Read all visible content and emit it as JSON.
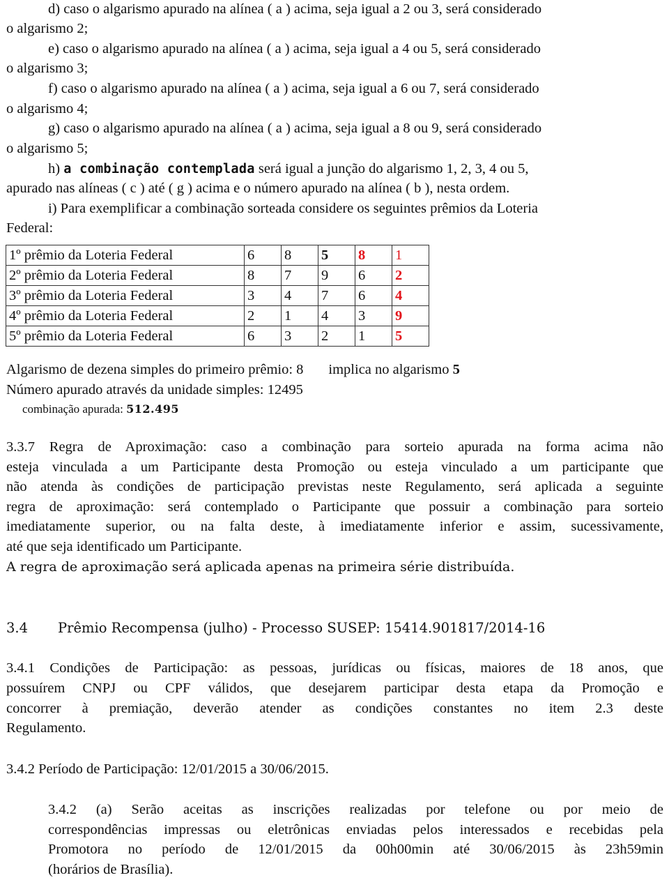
{
  "items": {
    "d": {
      "l1": "d) caso o algarismo apurado na alínea ( a ) acima, seja igual a 2 ou 3, será considerado",
      "l2": "o algarismo 2;"
    },
    "e": {
      "l1": "e) caso o algarismo apurado na alínea ( a ) acima, seja igual a 4 ou 5, será considerado",
      "l2": "o algarismo 3;"
    },
    "f": {
      "l1": "f) caso o algarismo apurado na alínea ( a ) acima, seja igual a 6 ou 7, será considerado",
      "l2": "o algarismo 4;"
    },
    "g": {
      "l1": "g) caso o algarismo apurado na alínea ( a ) acima, seja igual a 8 ou 9, será considerado",
      "l2": "o algarismo 5;"
    },
    "h": {
      "prefix": "h) ",
      "bold": "a combinação contemplada",
      "rest": " será igual a junção do algarismo 1, 2, 3, 4 ou 5,",
      "l2": "apurado nas alíneas ( c ) até ( g ) acima e o número apurado na alínea ( b ), nesta ordem."
    },
    "i": {
      "l1": "i) Para exemplificar a combinação sorteada considere os seguintes prêmios da Loteria",
      "l2": "Federal:"
    }
  },
  "lottery_table": [
    {
      "label": "1º prêmio da Loteria Federal",
      "digits": [
        "6",
        "8",
        "5",
        "8",
        "1"
      ]
    },
    {
      "label": "2º prêmio da Loteria Federal",
      "digits": [
        "8",
        "7",
        "9",
        "6",
        "2"
      ]
    },
    {
      "label": "3º prêmio da Loteria Federal",
      "digits": [
        "3",
        "4",
        "7",
        "6",
        "4"
      ]
    },
    {
      "label": "4º prêmio da Loteria Federal",
      "digits": [
        "2",
        "1",
        "4",
        "3",
        "9"
      ]
    },
    {
      "label": "5º prêmio da Loteria Federal",
      "digits": [
        "6",
        "3",
        "2",
        "1",
        "5"
      ]
    }
  ],
  "example": {
    "dezena_label": "Algarismo de dezena simples do primeiro prêmio: 8",
    "implica_label": "implica no algarismo ",
    "implica_value": "5",
    "numero_label": "Número apurado através da unidade simples: 12495",
    "combinacao_label": "combinação apurada: ",
    "combinacao_value": "512.495"
  },
  "s337": {
    "l1": "3.3.7   Regra de Aproximação: caso a combinação para sorteio apurada na forma acima não",
    "l2": "esteja vinculada a um Participante desta Promoção ou esteja vinculado a um participante que",
    "l3": "não atenda às condições de participação previstas neste Regulamento, será aplicada a seguinte",
    "l4": "regra de aproximação: será contemplado o Participante que possuir a combinação para sorteio",
    "l5": "imediatamente superior, ou na falta deste, à imediatamente inferior e assim, sucessivamente,",
    "l6": "até que seja identificado um Participante.",
    "l7": "A regra de aproximação será aplicada apenas na primeira série distribuída."
  },
  "s34": {
    "number": "3.4",
    "title": "Prêmio Recompensa (julho) - Processo SUSEP: 15414.901817/2014-16"
  },
  "s341": {
    "l1": "3.4.1   Condições de Participação: as pessoas, jurídicas ou físicas, maiores de 18 anos, que",
    "l2": "possuírem CNPJ ou CPF válidos, que desejarem participar desta etapa da Promoção e",
    "l3": "concorrer à premiação, deverão atender as condições constantes no item 2.3 deste",
    "l4": "Regulamento."
  },
  "s342": {
    "l1": "3.4.2   Período de Participação: 12/01/2015 a 30/06/2015."
  },
  "s342a": {
    "l1": "3.4.2 (a) Serão aceitas as inscrições realizadas por telefone ou por meio de",
    "l2": "correspondências impressas ou eletrônicas enviadas pelos interessados e recebidas pela",
    "l3": "Promotora no período de 12/01/2015 da 00h00min até 30/06/2015 às 23h59min",
    "l4": "(horários de Brasília)."
  },
  "colors": {
    "highlight_red": "#e3141b",
    "text": "#111111"
  }
}
